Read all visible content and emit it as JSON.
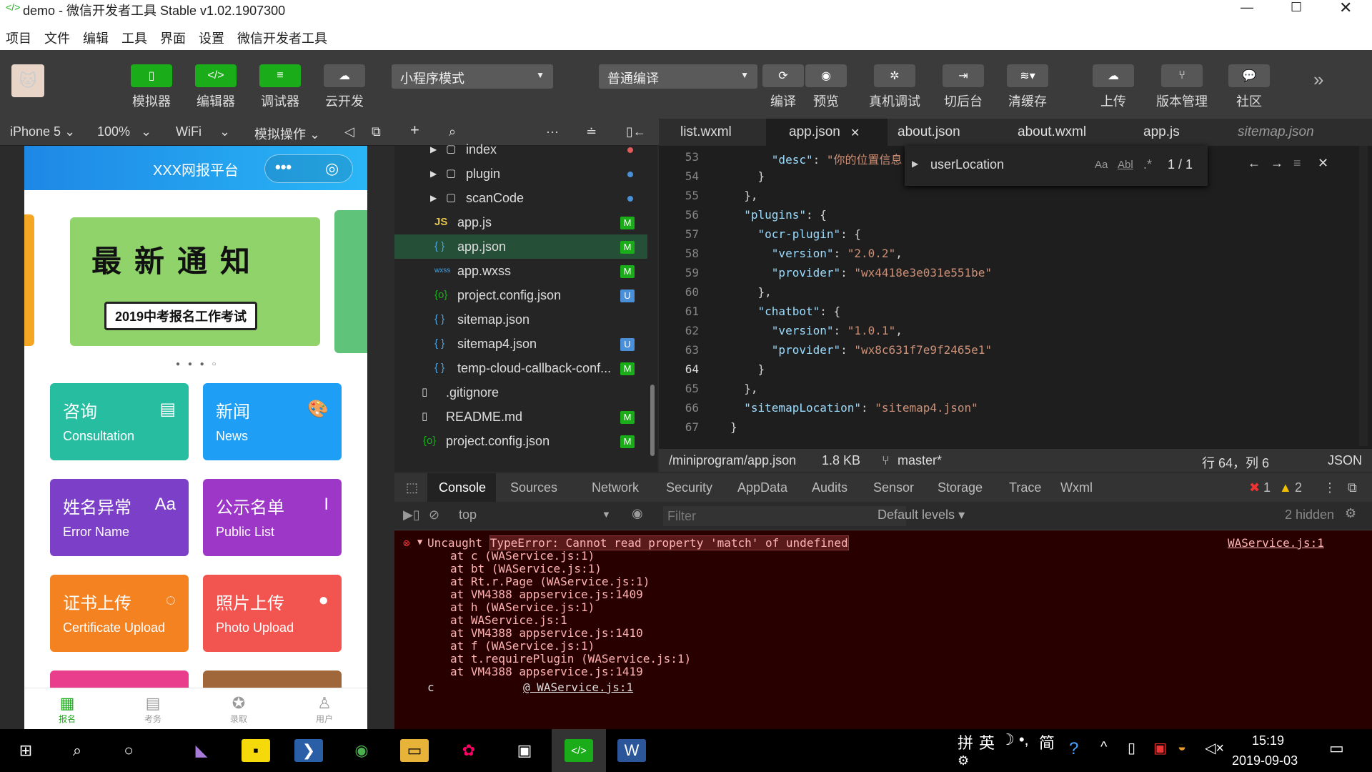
{
  "window": {
    "title": "demo - 微信开发者工具 Stable v1.02.1907300"
  },
  "menu": [
    "项目",
    "文件",
    "编辑",
    "工具",
    "界面",
    "设置",
    "微信开发者工具"
  ],
  "toolbar": {
    "simulator": "模拟器",
    "editor": "编辑器",
    "debugger": "调试器",
    "cloud": "云开发",
    "mode": "小程序模式",
    "compile_mode": "普通编译",
    "compile": "编译",
    "preview": "预览",
    "remote_debug": "真机调试",
    "background": "切后台",
    "clear_cache": "清缓存",
    "upload": "上传",
    "version": "版本管理",
    "community": "社区"
  },
  "subbar": {
    "device": "iPhone 5",
    "zoom": "100%",
    "network": "WiFi",
    "sim_ops": "模拟操作"
  },
  "phone": {
    "title": "XXX网报平台",
    "banner_big": "最新通知",
    "banner_sub": "2019中考报名工作考试",
    "tiles": [
      {
        "cn": "咨询",
        "en": "Consultation",
        "color": "#26bda0"
      },
      {
        "cn": "新闻",
        "en": "News",
        "color": "#1e9ef5"
      },
      {
        "cn": "姓名异常",
        "en": "Error Name",
        "color": "#7b3fc8"
      },
      {
        "cn": "公示名单",
        "en": "Public List",
        "color": "#9c37c7"
      },
      {
        "cn": "证书上传",
        "en": "Certificate Upload",
        "color": "#f58220"
      },
      {
        "cn": "照片上传",
        "en": "Photo Upload",
        "color": "#f2544f"
      }
    ],
    "tabs": [
      "报名",
      "考务",
      "录取",
      "用户"
    ]
  },
  "files": [
    {
      "name": "index",
      "type": "folder",
      "mark": "dot-red"
    },
    {
      "name": "plugin",
      "type": "folder",
      "mark": "dot-blue"
    },
    {
      "name": "scanCode",
      "type": "folder",
      "mark": "dot-blue"
    },
    {
      "name": "app.js",
      "type": "js",
      "mark": "M"
    },
    {
      "name": "app.json",
      "type": "json",
      "mark": "M"
    },
    {
      "name": "app.wxss",
      "type": "wxss",
      "mark": "M"
    },
    {
      "name": "project.config.json",
      "type": "cfg",
      "mark": "U"
    },
    {
      "name": "sitemap.json",
      "type": "json",
      "mark": ""
    },
    {
      "name": "sitemap4.json",
      "type": "json",
      "mark": "U"
    },
    {
      "name": "temp-cloud-callback-conf...",
      "type": "json",
      "mark": "M"
    },
    {
      "name": ".gitignore",
      "type": "file",
      "mark": ""
    },
    {
      "name": "README.md",
      "type": "file",
      "mark": "M"
    },
    {
      "name": "project.config.json",
      "type": "cfg",
      "mark": "M"
    }
  ],
  "editor_tabs": [
    "list.wxml",
    "app.json",
    "about.json",
    "about.wxml",
    "app.js",
    "sitemap.json"
  ],
  "code": [
    {
      "n": "53",
      "t": "      \"desc\": \"你的位置信息"
    },
    {
      "n": "54",
      "t": "    }"
    },
    {
      "n": "55",
      "t": "  },"
    },
    {
      "n": "56",
      "t": "  \"plugins\": {"
    },
    {
      "n": "57",
      "t": "    \"ocr-plugin\": {"
    },
    {
      "n": "58",
      "t": "      \"version\": \"2.0.2\","
    },
    {
      "n": "59",
      "t": "      \"provider\": \"wx4418e3e031e551be\""
    },
    {
      "n": "60",
      "t": "    },"
    },
    {
      "n": "61",
      "t": "    \"chatbot\": {"
    },
    {
      "n": "62",
      "t": "      \"version\": \"1.0.1\","
    },
    {
      "n": "63",
      "t": "      \"provider\": \"wx8c631f7e9f2465e1\""
    },
    {
      "n": "64",
      "t": "    }"
    },
    {
      "n": "65",
      "t": "  },"
    },
    {
      "n": "66",
      "t": "  \"sitemapLocation\": \"sitemap4.json\""
    },
    {
      "n": "67",
      "t": "}"
    }
  ],
  "find": {
    "query": "userLocation",
    "count": "1 / 1"
  },
  "status": {
    "path": "/miniprogram/app.json",
    "size": "1.8 KB",
    "branch": "master*",
    "pos": "行 64，列 6",
    "lang": "JSON"
  },
  "devtools": {
    "tabs": [
      "Console",
      "Sources",
      "Network",
      "Security",
      "AppData",
      "Audits",
      "Sensor",
      "Storage",
      "Trace",
      "Wxml"
    ],
    "errors": "1",
    "warnings": "2",
    "context": "top",
    "filter_placeholder": "Filter",
    "levels": "Default levels",
    "hidden": "2 hidden"
  },
  "console": {
    "error": "Uncaught TypeError: Cannot read property 'match' of undefined",
    "source": "WAService.js:1",
    "stack": [
      "at c (WAService.js:1)",
      "at bt (WAService.js:1)",
      "at Rt.r.Page (WAService.js:1)",
      "at VM4388 appservice.js:1409",
      "at h (WAService.js:1)",
      "at WAService.js:1",
      "at VM4388 appservice.js:1410",
      "at f (WAService.js:1)",
      "at t.requirePlugin (WAService.js:1)",
      "at VM4388 appservice.js:1419"
    ],
    "last_c": "c",
    "last_src": "@ WAService.js:1"
  },
  "taskbar": {
    "ime1": "拼",
    "ime2": "英",
    "ime3": "简",
    "time": "15:19",
    "date": "2019-09-03"
  }
}
